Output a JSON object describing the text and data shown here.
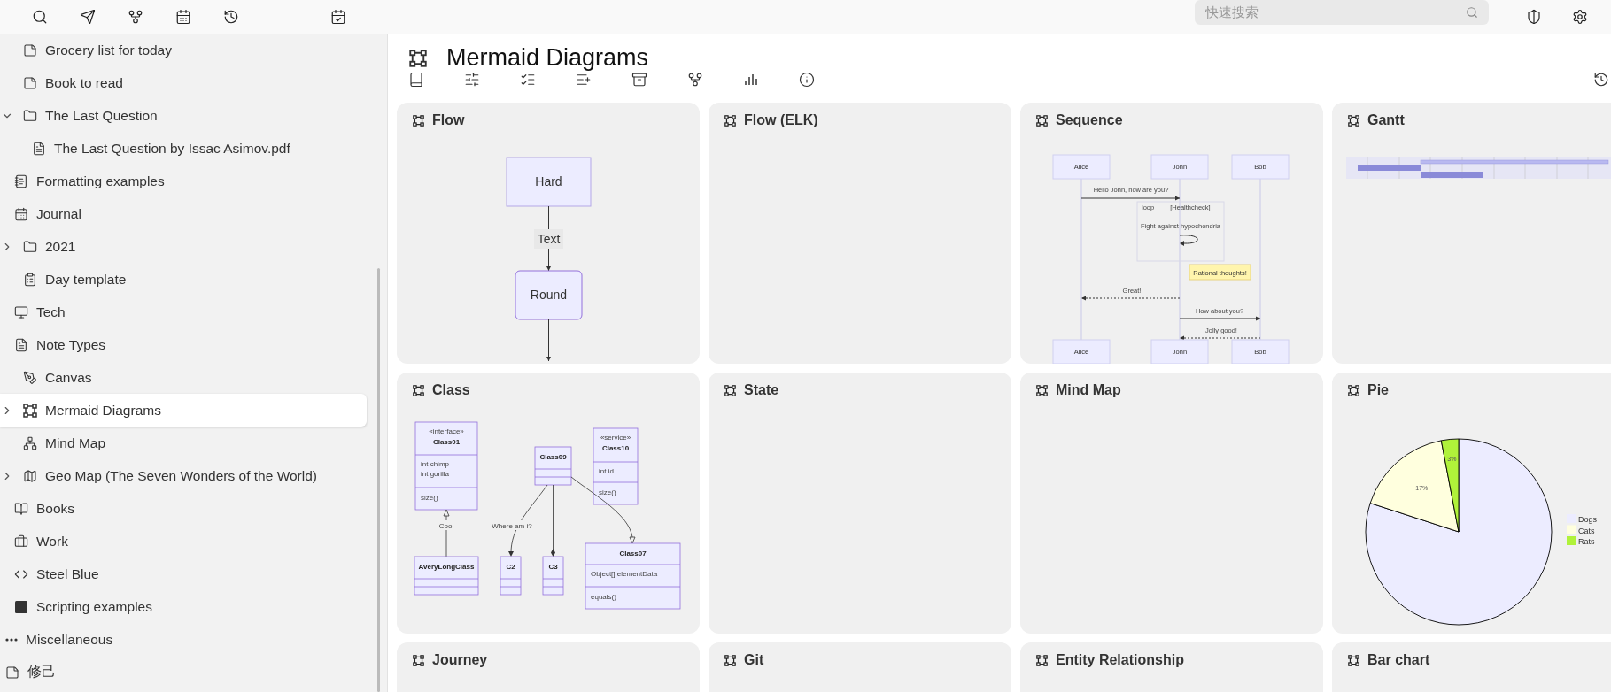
{
  "top_bar": {
    "search": {
      "placeholder": "快速搜索"
    }
  },
  "sidebar": {
    "partial_items": [
      {
        "label": "Grocery list for today",
        "kind": "note",
        "selected": false
      },
      {
        "label": "Book to read",
        "kind": "note",
        "selected": false
      },
      {
        "label": "The Last Question",
        "kind": "folder",
        "selected": false,
        "expanded": true,
        "children": [
          {
            "label": "The Last Question by Issac Asimov.pdf",
            "kind": "pdf",
            "selected": false
          }
        ]
      }
    ],
    "items": [
      {
        "label": "Formatting examples",
        "kind": "book",
        "selected": false
      },
      {
        "label": "Journal",
        "kind": "calendar",
        "selected": false,
        "children": [
          {
            "label": "2021",
            "kind": "folder",
            "selected": false,
            "expanded": false
          },
          {
            "label": "Day template",
            "kind": "template",
            "selected": false
          }
        ]
      },
      {
        "label": "Tech",
        "kind": "desktop",
        "selected": false
      },
      {
        "label": "Note Types",
        "kind": "doc",
        "selected": false,
        "children": [
          {
            "label": "Canvas",
            "kind": "canvas",
            "selected": false
          },
          {
            "label": "Mermaid Diagrams",
            "kind": "mermaid",
            "selected": true,
            "expanded": false
          },
          {
            "label": "Mind Map",
            "kind": "mindmap",
            "selected": false
          },
          {
            "label": "Geo Map (The Seven Wonders of the World)",
            "kind": "geomap",
            "selected": false,
            "expanded": false
          }
        ]
      },
      {
        "label": "Books",
        "kind": "books",
        "selected": false
      },
      {
        "label": "Work",
        "kind": "work",
        "selected": false
      },
      {
        "label": "Steel Blue",
        "kind": "code",
        "selected": false
      },
      {
        "label": "Scripting examples",
        "kind": "script",
        "selected": false
      }
    ],
    "root_items": [
      {
        "label": "Miscellaneous",
        "kind": "more",
        "selected": false
      },
      {
        "label": "修己",
        "kind": "note",
        "selected": false
      }
    ]
  },
  "note": {
    "title": "Mermaid Diagrams"
  },
  "cards": [
    {
      "title": "Flow",
      "kind": "flow",
      "nodes": [
        "Hard",
        "Round"
      ],
      "edge_label": "Text"
    },
    {
      "title": "Flow (ELK)",
      "kind": "empty"
    },
    {
      "title": "Sequence",
      "kind": "sequence",
      "actors": [
        "Alice",
        "John",
        "Bob"
      ],
      "messages": [
        "Hello John, how are you?",
        "Fight against hypochondria",
        "Great!",
        "How about you?",
        "Jolly good!"
      ],
      "loop": {
        "label": "loop",
        "condition": "[Healthcheck]"
      },
      "note": "Rational thoughts!",
      "footer_actors": [
        "Alice",
        "John",
        "Bob"
      ]
    },
    {
      "title": "Gantt",
      "kind": "gantt"
    },
    {
      "title": "Class",
      "kind": "class",
      "classes": [
        {
          "stereotype": "«interface»",
          "name": "Class01",
          "members": [
            "int chimp",
            "int gorilla"
          ],
          "methods": [
            "size()"
          ]
        },
        {
          "name": "AveryLongClass"
        },
        {
          "name": "Class09"
        },
        {
          "name": "C2"
        },
        {
          "name": "C3"
        },
        {
          "stereotype": "«service»",
          "name": "Class10",
          "members": [
            "int id"
          ],
          "methods": [
            "size()"
          ]
        },
        {
          "name": "Class07",
          "members": [
            "Object[] elementData"
          ],
          "methods": [
            "equals()"
          ]
        }
      ],
      "edge_labels": [
        "Cool",
        "Where am i?"
      ]
    },
    {
      "title": "State",
      "kind": "empty"
    },
    {
      "title": "Mind Map",
      "kind": "empty"
    },
    {
      "title": "Pie",
      "kind": "pie",
      "chart_data": {
        "type": "pie",
        "categories": [
          "Dogs",
          "Cats",
          "Rats"
        ],
        "values": [
          80,
          17,
          3
        ],
        "value_labels": [
          null,
          "17%",
          "3%"
        ],
        "legend": "right"
      }
    },
    {
      "title": "Journey",
      "kind": "empty"
    },
    {
      "title": "Git",
      "kind": "empty"
    },
    {
      "title": "Entity Relationship",
      "kind": "empty"
    },
    {
      "title": "Bar chart",
      "kind": "empty"
    }
  ]
}
